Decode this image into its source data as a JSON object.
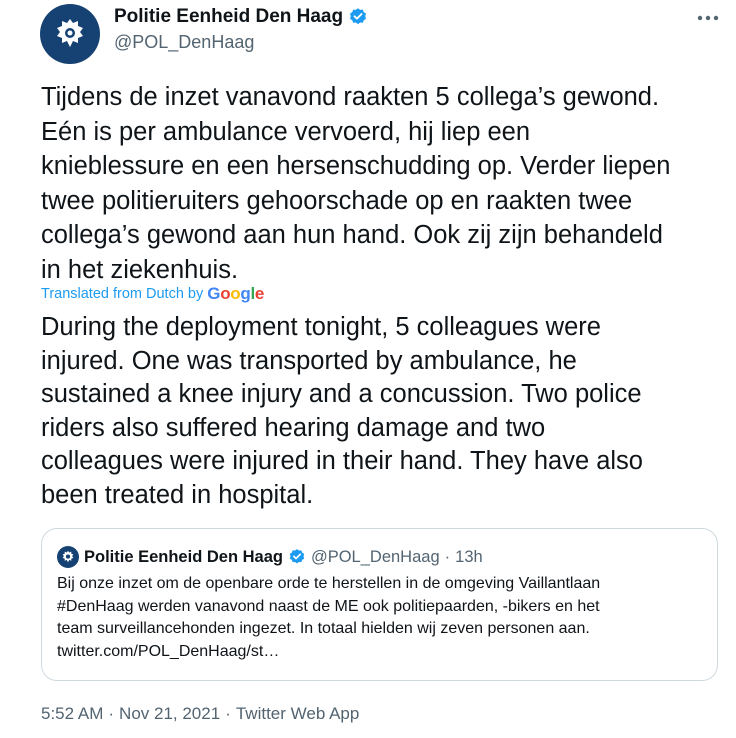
{
  "author": {
    "name": "Politie Eenheid Den Haag",
    "handle": "@POL_DenHaag",
    "verified": true
  },
  "tweet": {
    "text": "Tijdens de inzet vanavond raakten 5 collega’s gewond.\nEén is per ambulance vervoerd, hij liep een\nknieblessure en een hersenschudding op. Verder liepen\ntwee politieruiters gehoorschade op en raakten twee\ncollega’s gewond aan hun hand. Ook zij zijn behandeld\nin het ziekenhuis.",
    "translated_label": "Translated from Dutch by",
    "translator": "Google",
    "translation": "During the deployment tonight, 5 colleagues were\ninjured. One was transported by ambulance, he\nsustained a knee injury and a concussion. Two police\nriders also suffered hearing damage and two\ncolleagues were injured in their hand. They have also\nbeen treated in hospital."
  },
  "quote": {
    "name": "Politie Eenheid Den Haag",
    "handle": "@POL_DenHaag",
    "separator": "·",
    "time": "13h",
    "text": "Bij onze inzet om de openbare orde te herstellen in de omgeving Vaillantlaan\n#DenHaag werden vanavond naast de ME ook politiepaarden, -bikers en het\nteam surveillancehonden ingezet. In totaal hielden wij zeven personen aan.\ntwitter.com/POL_DenHaag/st…"
  },
  "meta": {
    "time": "5:52 AM",
    "sep1": "·",
    "date": "Nov 21, 2021",
    "sep2": "·",
    "source": "Twitter Web App"
  },
  "colors": {
    "verified": "#1d9bf0",
    "police_blue": "#154273",
    "link": "#1d9bf0",
    "secondary_text": "#536471",
    "border": "#cfd9de"
  },
  "icons": {
    "avatar": "police-badge-icon",
    "verified": "verified-badge-icon",
    "more": "more-horizontal-icon"
  }
}
